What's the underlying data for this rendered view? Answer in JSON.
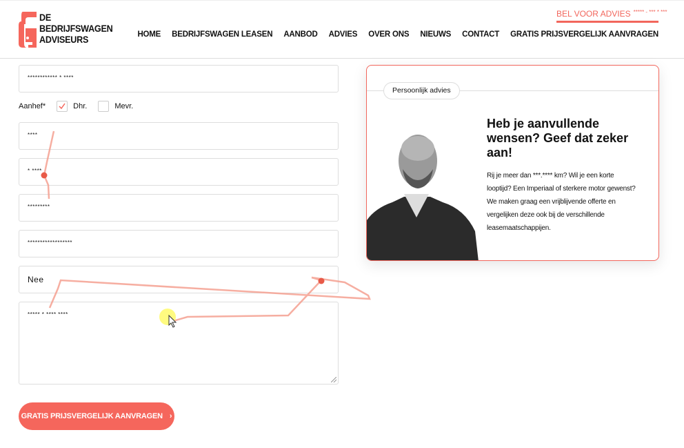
{
  "brand": {
    "line1": "DE",
    "line2": "BEDRIJFSWAGEN",
    "line3": "ADVISEURS",
    "accent": "#f5665c"
  },
  "header": {
    "bel_label": "BEL VOOR ADVIES",
    "phone": "***** - *** * ***",
    "nav": [
      "HOME",
      "BEDRIJFSWAGEN LEASEN",
      "AANBOD",
      "ADVIES",
      "OVER ONS",
      "NIEUWS",
      "CONTACT",
      "GRATIS PRIJSVERGELIJK AANVRAGEN"
    ]
  },
  "form": {
    "field1": "************ * ****",
    "aanhef_label": "Aanhef*",
    "option_dhr": "Dhr.",
    "option_mevr": "Mevr.",
    "dhr_checked": true,
    "field2": "****",
    "field3": "* ****",
    "field4": "*********",
    "field5": "******************",
    "select_value": "Nee",
    "textarea": "***** * **** ****",
    "submit": "GRATIS PRIJSVERGELIJK AANVRAGEN"
  },
  "card": {
    "tag": "Persoonlijk advies",
    "heading": "Heb je aanvullende wensen? Geef dat zeker aan!",
    "body": "Rij je meer dan ***.**** km? Wil je een korte looptijd? Een Imperiaal of sterkere motor gewenst? We maken graag een vrijblijvende offerte en vergelijken deze ook bij de verschillende leasemaatschappijen."
  }
}
